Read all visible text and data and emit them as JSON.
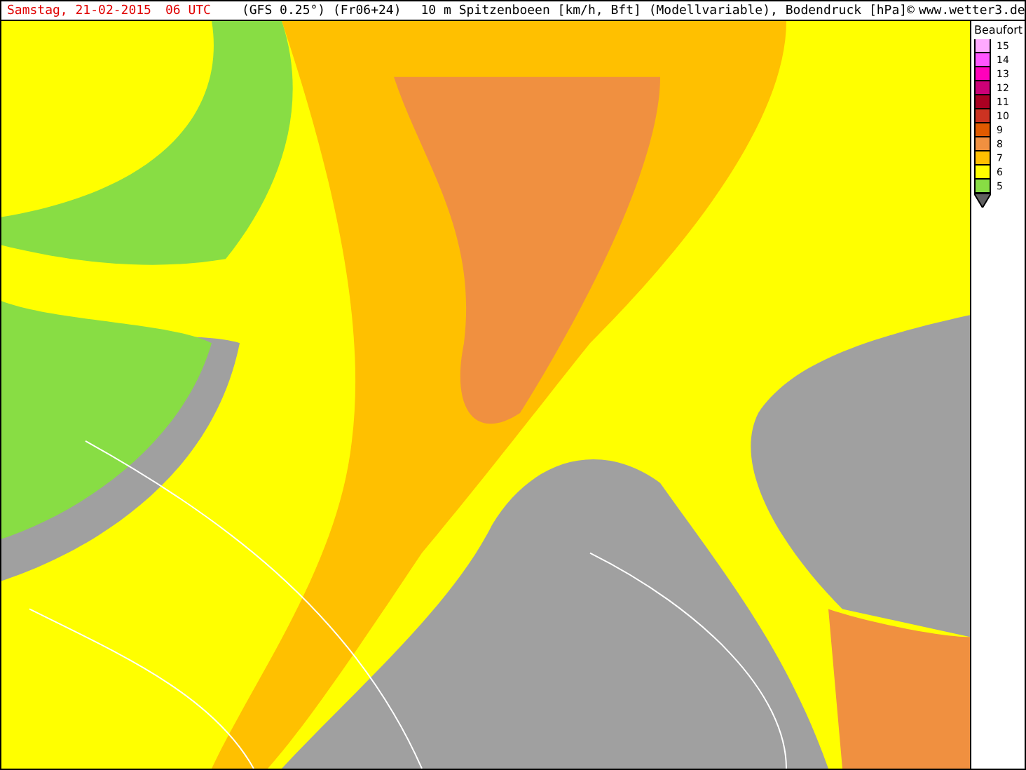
{
  "header": {
    "date": "Samstag, 21-02-2015",
    "time": "06 UTC",
    "model": "(GFS 0.25°) (Fr06+24)",
    "title": "10 m Spitzenboeen [km/h, Bft] (Modellvariable), Bodendruck [hPa]",
    "copyright": "©",
    "site": "www.wetter3.de"
  },
  "legend": {
    "title": "Beaufort",
    "steps": [
      {
        "label": "15",
        "color": "#ffaaff"
      },
      {
        "label": "14",
        "color": "#ff55ff"
      },
      {
        "label": "13",
        "color": "#ff00bb"
      },
      {
        "label": "12",
        "color": "#cc0077"
      },
      {
        "label": "11",
        "color": "#aa0022"
      },
      {
        "label": "10",
        "color": "#cc3322"
      },
      {
        "label": "9",
        "color": "#e05a00"
      },
      {
        "label": "8",
        "color": "#f09040"
      },
      {
        "label": "7",
        "color": "#ffc000"
      },
      {
        "label": "6",
        "color": "#ffff00"
      },
      {
        "label": "5",
        "color": "#88dd44"
      }
    ]
  }
}
